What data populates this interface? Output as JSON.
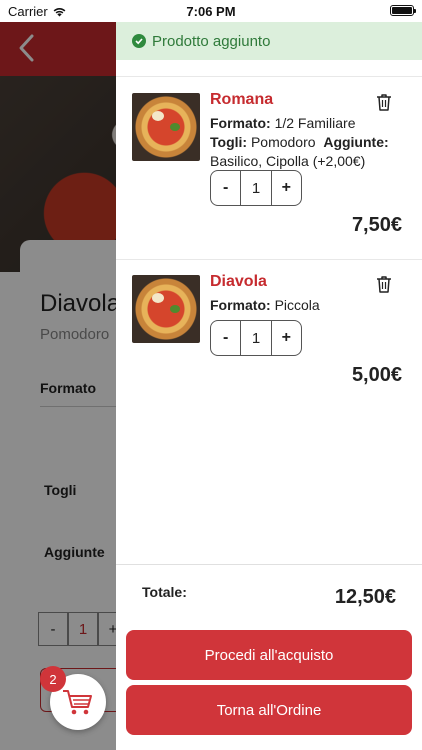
{
  "status_bar": {
    "carrier": "Carrier",
    "time": "7:06 PM"
  },
  "background": {
    "product_title": "Diavola",
    "product_subtitle": "Pomodoro",
    "formato_label": "Formato",
    "togli_label": "Togli",
    "aggiunte_label": "Aggiunte",
    "stepper": {
      "minus": "-",
      "value": "1",
      "plus": "+"
    }
  },
  "cart_fab": {
    "badge": "2"
  },
  "toast": {
    "message": "Prodotto aggiunto"
  },
  "cart": {
    "items": [
      {
        "name": "Romana",
        "formato_label": "Formato:",
        "formato_value": "1/2 Familiare",
        "togli_label": "Togli:",
        "togli_value": "Pomodoro",
        "aggiunte_label": "Aggiunte:",
        "aggiunte_value": "Basilico, Cipolla (+2,00€)",
        "qty": "1",
        "minus": "-",
        "plus": "+",
        "price": "7,50€"
      },
      {
        "name": "Diavola",
        "formato_label": "Formato:",
        "formato_value": "Piccola",
        "qty": "1",
        "minus": "-",
        "plus": "+",
        "price": "5,00€"
      }
    ],
    "total_label": "Totale:",
    "total_value": "12,50€",
    "checkout_label": "Procedi all'acquisto",
    "back_label": "Torna all'Ordine"
  },
  "colors": {
    "brand_red": "#c62b2f",
    "button_red": "#d0353a",
    "toast_bg": "#dcefdc",
    "toast_text": "#2f7a3a"
  }
}
